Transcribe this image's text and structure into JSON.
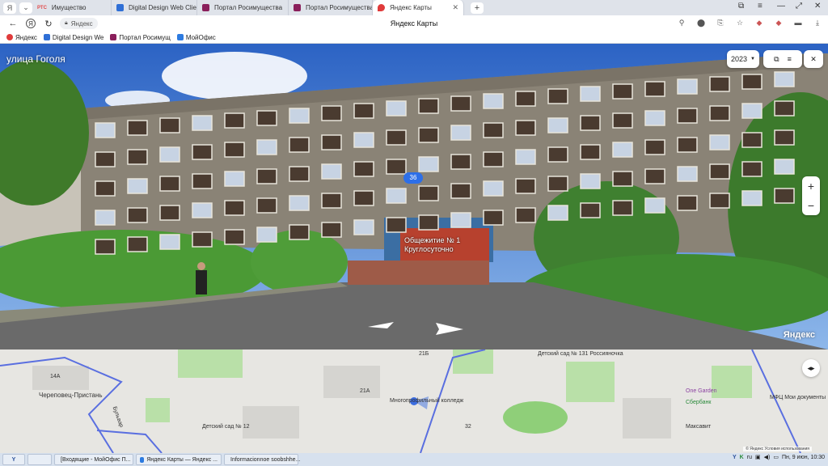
{
  "tabs": [
    {
      "label": "Имущество",
      "favicon_color": "#e34a4a",
      "favicon_label": "РТС"
    },
    {
      "label": "Digital Design Web Client",
      "favicon_color": "#2f6fd6"
    },
    {
      "label": "Портал Росимущества",
      "favicon_color": "#8a1f5b"
    },
    {
      "label": "Портал Росимущества",
      "favicon_color": "#8a1f5b"
    },
    {
      "label": "Яндекс Карты",
      "favicon_color": "#e03b3b",
      "active": true
    }
  ],
  "tab_prefix": {
    "profile": "Я",
    "dropdown": "⌄",
    "rts": "РТС"
  },
  "addressbar": {
    "back": "←",
    "yandex_btn": "Я",
    "reload": "↻",
    "address_label": "Яндекс",
    "page_title": "Яндекс Карты"
  },
  "bookmarks": [
    {
      "label": "Яндекс",
      "color": "#e03b3b"
    },
    {
      "label": "Digital Design We",
      "color": "#2f6fd6"
    },
    {
      "label": "Портал Росимущ",
      "color": "#8a1f5b"
    },
    {
      "label": "МойОфис",
      "color": "#2d7be0"
    }
  ],
  "panorama": {
    "street_name": "улица Гоголя",
    "year": "2023",
    "house_number": "36",
    "sign_line1": "Общежитие № 1",
    "sign_line2": "Круглосуточно",
    "logo": "Яндекс"
  },
  "map": {
    "labels": {
      "pristan": "Череповец-Пристань",
      "college": "Многопрофильный колледж",
      "school": "Детский сад № 131 Россияночка",
      "kinder": "Детский сад № 12",
      "one_garden": "One Garden",
      "sber": "Сбербанк",
      "maxavit": "Максавит",
      "mfc": "МФЦ Мои документы",
      "street": "Бульвар",
      "road": "21А",
      "road2": "21Б",
      "road3": "14А",
      "road4": "32"
    },
    "footer": "© Яндекс  Условия использования"
  },
  "taskbar": {
    "start": "Y",
    "tasks": [
      {
        "label": "[Входящие - МойОфис П...",
        "color": "#2d7be0"
      },
      {
        "label": "Яндекс Карты — Яндекс ...",
        "color": "#e03b3b"
      },
      {
        "label": "Informacionnoe soobshhe...",
        "color": "#555"
      }
    ],
    "lang": "ru",
    "clock": "Пн, 9 июн, 10:30"
  }
}
